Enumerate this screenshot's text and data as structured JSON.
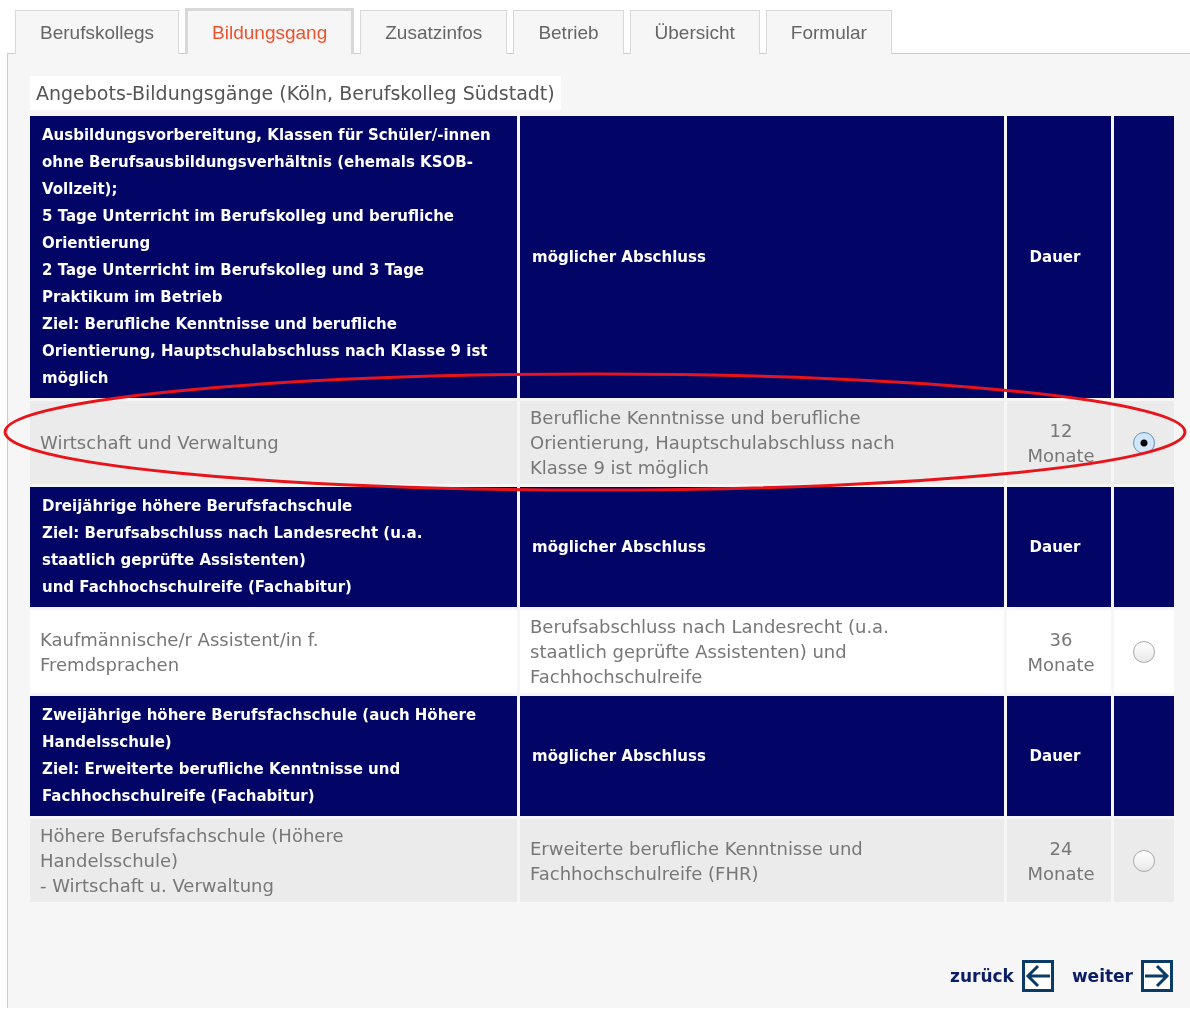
{
  "tabs": [
    {
      "label": "Berufskollegs",
      "selected": false
    },
    {
      "label": "Bildungsgang",
      "selected": true
    },
    {
      "label": "Zusatzinfos",
      "selected": false
    },
    {
      "label": "Betrieb",
      "selected": false
    },
    {
      "label": "Übersicht",
      "selected": false
    },
    {
      "label": "Formular",
      "selected": false
    }
  ],
  "heading": "Angebots-Bildungsgänge (Köln, Berufskolleg Südstadt)",
  "groups": [
    {
      "header": {
        "title_lines": [
          "Ausbildungsvorbereitung, Klassen für Schüler/-innen ohne Berufsausbildungsverhältnis (ehemals KSOB-Vollzeit);",
          "5 Tage Unterricht im Berufskolleg und berufliche Orientierung",
          "2 Tage Unterricht im Berufskolleg und 3 Tage Praktikum im Betrieb",
          "Ziel: Berufliche Kenntnisse und berufliche Orientierung, Hauptschulabschluss nach Klasse 9 ist möglich"
        ],
        "column_2": "möglicher Abschluss",
        "column_3": "Dauer"
      },
      "rows": [
        {
          "name_lines": [
            "Wirtschaft und Verwaltung"
          ],
          "abschluss": "Berufliche Kenntnisse und berufliche Orientierung, Hauptschulabschluss nach Klasse 9 ist möglich",
          "dauer": "12 Monate",
          "selected": true,
          "highlighted": true
        }
      ]
    },
    {
      "header": {
        "title_lines": [
          "Dreijährige höhere Berufsfachschule",
          "Ziel: Berufsabschluss nach Landesrecht (u.a. staatlich geprüfte Assistenten)",
          "und Fachhochschulreife (Fachabitur)"
        ],
        "column_2": "möglicher Abschluss",
        "column_3": "Dauer"
      },
      "rows": [
        {
          "name_lines": [
            "Kaufmännische/r Assistent/in f. Fremdsprachen"
          ],
          "abschluss": "Berufsabschluss nach Landesrecht (u.a. staatlich geprüfte Assistenten) und Fachhochschulreife",
          "dauer": "36 Monate",
          "selected": false,
          "highlighted": false
        }
      ]
    },
    {
      "header": {
        "title_lines": [
          "Zweijährige höhere Berufsfachschule (auch Höhere Handelsschule)",
          "Ziel: Erweiterte berufliche Kenntnisse und Fachhochschulreife (Fachabitur)"
        ],
        "column_2": "möglicher Abschluss",
        "column_3": "Dauer"
      },
      "rows": [
        {
          "name_lines": [
            "Höhere Berufsfachschule (Höhere Handelsschule)",
            "- Wirtschaft u. Verwaltung"
          ],
          "abschluss": "Erweiterte berufliche Kenntnisse und Fachhochschulreife (FHR)",
          "dauer": "24 Monate",
          "selected": false,
          "highlighted": false
        }
      ]
    }
  ],
  "nav": {
    "back": "zurück",
    "next": "weiter"
  }
}
